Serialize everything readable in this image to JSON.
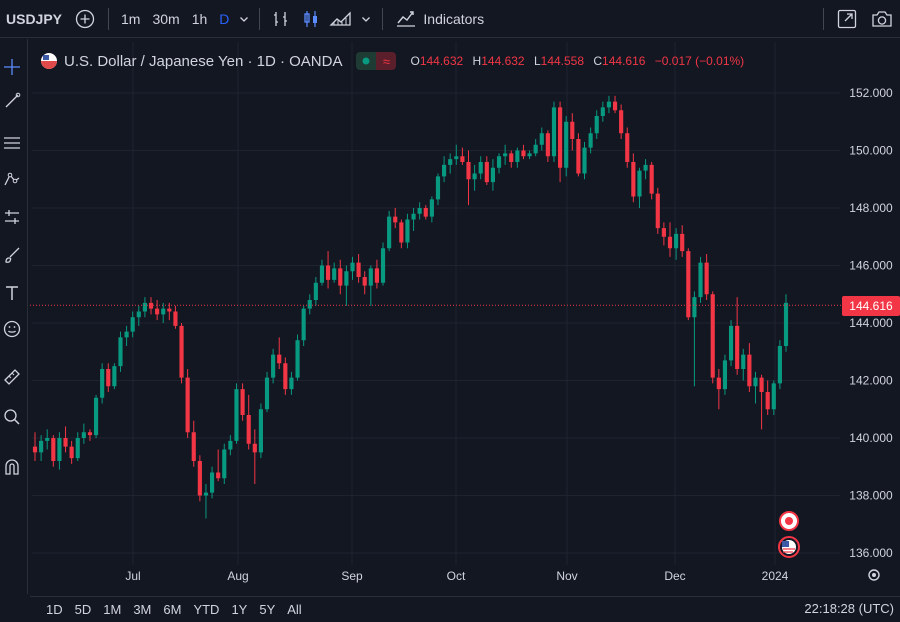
{
  "toolbar": {
    "symbol": "USDJPY",
    "timeframes": [
      "1m",
      "30m",
      "1h",
      "D"
    ],
    "active_timeframe": "D",
    "indicators_label": "Indicators"
  },
  "legend": {
    "title": "U.S. Dollar / Japanese Yen · 1D · OANDA",
    "ohlc": [
      {
        "k": "O",
        "v": "144.632"
      },
      {
        "k": "H",
        "v": "144.632"
      },
      {
        "k": "L",
        "v": "144.558"
      },
      {
        "k": "C",
        "v": "144.616"
      }
    ],
    "change": "−0.017 (−0.01%)"
  },
  "price_axis": {
    "ticks": [
      "152.000",
      "150.000",
      "148.000",
      "146.000",
      "144.000",
      "142.000",
      "140.000",
      "138.000",
      "136.000"
    ],
    "current_price": "144.616"
  },
  "time_axis": {
    "ticks": [
      "Jul",
      "Aug",
      "Sep",
      "Oct",
      "Nov",
      "Dec",
      "2024"
    ]
  },
  "bottom": {
    "ranges": [
      "1D",
      "5D",
      "1M",
      "3M",
      "6M",
      "YTD",
      "1Y",
      "5Y",
      "All"
    ],
    "clock": "22:18:28 (UTC)"
  },
  "colors": {
    "background": "#131722",
    "up": "#089981",
    "down": "#f23645",
    "grid": "#1f2330",
    "accent": "#2962ff"
  },
  "chart_data": {
    "type": "candlestick",
    "title": "U.S. Dollar / Japanese Yen · 1D · OANDA",
    "ylim": [
      135.6,
      153.0
    ],
    "current_price": 144.616,
    "candles_ohlc": [
      [
        139.7,
        140.2,
        139.2,
        139.5
      ],
      [
        139.5,
        140.1,
        139.2,
        139.9
      ],
      [
        139.9,
        140.3,
        139.6,
        140.0
      ],
      [
        140.0,
        140.1,
        139.0,
        139.2
      ],
      [
        139.2,
        140.2,
        138.9,
        140.0
      ],
      [
        140.0,
        140.4,
        139.5,
        139.7
      ],
      [
        139.7,
        139.9,
        139.1,
        139.3
      ],
      [
        139.3,
        140.2,
        139.2,
        140.0
      ],
      [
        140.0,
        140.5,
        139.8,
        140.2
      ],
      [
        140.2,
        140.3,
        139.9,
        140.1
      ],
      [
        140.1,
        141.5,
        140.0,
        141.4
      ],
      [
        141.4,
        142.6,
        141.2,
        142.4
      ],
      [
        142.4,
        142.6,
        141.6,
        141.8
      ],
      [
        141.8,
        142.6,
        141.7,
        142.5
      ],
      [
        142.5,
        143.7,
        142.3,
        143.5
      ],
      [
        143.5,
        143.9,
        143.2,
        143.7
      ],
      [
        143.7,
        144.4,
        143.5,
        144.2
      ],
      [
        144.2,
        144.6,
        143.9,
        144.4
      ],
      [
        144.4,
        144.9,
        144.2,
        144.7
      ],
      [
        144.7,
        144.9,
        144.3,
        144.5
      ],
      [
        144.5,
        144.8,
        144.1,
        144.3
      ],
      [
        144.3,
        144.7,
        144.0,
        144.5
      ],
      [
        144.5,
        144.7,
        144.1,
        144.4
      ],
      [
        144.4,
        144.6,
        143.8,
        143.9
      ],
      [
        143.9,
        144.0,
        141.9,
        142.1
      ],
      [
        142.1,
        142.4,
        140.0,
        140.2
      ],
      [
        140.2,
        140.6,
        139.0,
        139.2
      ],
      [
        139.2,
        139.4,
        137.8,
        138.0
      ],
      [
        138.0,
        138.4,
        137.2,
        138.1
      ],
      [
        138.1,
        139.0,
        137.9,
        138.8
      ],
      [
        138.8,
        139.6,
        138.5,
        138.6
      ],
      [
        138.6,
        139.8,
        138.4,
        139.6
      ],
      [
        139.6,
        140.1,
        139.4,
        139.9
      ],
      [
        139.9,
        141.9,
        139.8,
        141.7
      ],
      [
        141.7,
        141.9,
        140.6,
        140.8
      ],
      [
        140.8,
        141.5,
        139.6,
        139.8
      ],
      [
        139.8,
        140.3,
        138.4,
        139.5
      ],
      [
        139.5,
        141.2,
        139.3,
        141.0
      ],
      [
        141.0,
        142.3,
        140.9,
        142.1
      ],
      [
        142.1,
        143.1,
        141.9,
        142.9
      ],
      [
        142.9,
        143.5,
        142.4,
        142.6
      ],
      [
        142.6,
        142.8,
        141.5,
        141.7
      ],
      [
        141.7,
        142.3,
        141.5,
        142.1
      ],
      [
        142.1,
        143.6,
        142.0,
        143.4
      ],
      [
        143.4,
        144.6,
        143.2,
        144.5
      ],
      [
        144.5,
        145.0,
        144.3,
        144.8
      ],
      [
        144.8,
        145.6,
        144.6,
        145.4
      ],
      [
        145.4,
        146.2,
        145.3,
        146.0
      ],
      [
        146.0,
        146.5,
        145.2,
        145.5
      ],
      [
        145.5,
        146.1,
        145.4,
        145.9
      ],
      [
        145.9,
        146.2,
        145.0,
        145.3
      ],
      [
        145.3,
        146.0,
        144.6,
        145.8
      ],
      [
        145.8,
        146.3,
        145.5,
        146.1
      ],
      [
        146.1,
        146.4,
        145.4,
        145.6
      ],
      [
        145.6,
        145.8,
        145.0,
        145.3
      ],
      [
        145.3,
        146.0,
        144.6,
        145.9
      ],
      [
        145.9,
        146.2,
        145.2,
        145.4
      ],
      [
        145.4,
        146.8,
        145.3,
        146.6
      ],
      [
        146.6,
        147.9,
        146.5,
        147.7
      ],
      [
        147.7,
        148.0,
        147.3,
        147.5
      ],
      [
        147.5,
        147.6,
        146.6,
        146.8
      ],
      [
        146.8,
        147.8,
        146.6,
        147.6
      ],
      [
        147.6,
        148.0,
        147.2,
        147.8
      ],
      [
        147.8,
        148.2,
        147.6,
        148.0
      ],
      [
        148.0,
        148.1,
        147.6,
        147.7
      ],
      [
        147.7,
        148.4,
        147.5,
        148.3
      ],
      [
        148.3,
        149.2,
        148.1,
        149.1
      ],
      [
        149.1,
        149.8,
        148.9,
        149.5
      ],
      [
        149.5,
        149.9,
        149.2,
        149.7
      ],
      [
        149.7,
        150.2,
        149.5,
        149.8
      ],
      [
        149.8,
        150.1,
        149.5,
        149.6
      ],
      [
        149.6,
        150.0,
        148.1,
        149.0
      ],
      [
        149.0,
        149.5,
        148.6,
        149.2
      ],
      [
        149.2,
        149.8,
        149.0,
        149.6
      ],
      [
        149.6,
        149.8,
        148.8,
        148.9
      ],
      [
        148.9,
        149.7,
        148.6,
        149.4
      ],
      [
        149.4,
        149.9,
        149.2,
        149.8
      ],
      [
        149.8,
        150.2,
        149.5,
        149.9
      ],
      [
        149.9,
        150.0,
        149.4,
        149.6
      ],
      [
        149.6,
        150.1,
        149.4,
        150.0
      ],
      [
        150.0,
        150.2,
        149.7,
        149.8
      ],
      [
        149.8,
        150.0,
        149.7,
        149.9
      ],
      [
        149.9,
        150.4,
        149.8,
        150.2
      ],
      [
        150.2,
        150.8,
        150.0,
        150.6
      ],
      [
        150.6,
        150.7,
        149.6,
        149.8
      ],
      [
        149.8,
        151.7,
        149.6,
        151.5
      ],
      [
        151.5,
        151.7,
        148.9,
        149.4
      ],
      [
        149.4,
        151.2,
        149.1,
        151.0
      ],
      [
        151.0,
        151.3,
        150.0,
        150.4
      ],
      [
        150.4,
        150.6,
        149.1,
        149.2
      ],
      [
        149.2,
        150.3,
        149.0,
        150.1
      ],
      [
        150.1,
        150.8,
        149.9,
        150.6
      ],
      [
        150.6,
        151.4,
        150.4,
        151.2
      ],
      [
        151.2,
        151.7,
        151.0,
        151.5
      ],
      [
        151.5,
        151.9,
        151.3,
        151.7
      ],
      [
        151.7,
        151.9,
        151.3,
        151.4
      ],
      [
        151.4,
        151.6,
        150.4,
        150.6
      ],
      [
        150.6,
        150.8,
        149.4,
        149.6
      ],
      [
        149.6,
        149.9,
        148.2,
        148.4
      ],
      [
        148.4,
        149.4,
        148.0,
        149.3
      ],
      [
        149.3,
        149.7,
        149.0,
        149.5
      ],
      [
        149.5,
        149.6,
        148.3,
        148.5
      ],
      [
        148.5,
        148.7,
        147.1,
        147.3
      ],
      [
        147.3,
        147.5,
        146.7,
        147.0
      ],
      [
        147.0,
        147.5,
        146.3,
        146.6
      ],
      [
        146.6,
        147.3,
        146.2,
        147.1
      ],
      [
        147.1,
        147.4,
        146.3,
        146.5
      ],
      [
        146.5,
        146.6,
        144.1,
        144.2
      ],
      [
        144.2,
        145.1,
        141.8,
        144.9
      ],
      [
        144.9,
        146.3,
        144.7,
        146.1
      ],
      [
        146.1,
        146.4,
        144.8,
        145.0
      ],
      [
        145.0,
        145.1,
        141.9,
        142.1
      ],
      [
        142.1,
        142.4,
        141.0,
        141.7
      ],
      [
        141.7,
        142.9,
        141.5,
        142.7
      ],
      [
        142.7,
        144.1,
        142.5,
        143.9
      ],
      [
        143.9,
        144.9,
        142.2,
        142.4
      ],
      [
        142.4,
        143.1,
        142.0,
        142.9
      ],
      [
        142.9,
        143.3,
        141.6,
        141.8
      ],
      [
        141.8,
        142.3,
        141.2,
        142.1
      ],
      [
        142.1,
        142.2,
        140.3,
        141.6
      ],
      [
        141.6,
        142.0,
        140.8,
        141.0
      ],
      [
        141.0,
        142.0,
        140.8,
        141.9
      ],
      [
        141.9,
        143.4,
        141.7,
        143.2
      ],
      [
        143.2,
        145.0,
        143.0,
        144.7
      ]
    ]
  }
}
